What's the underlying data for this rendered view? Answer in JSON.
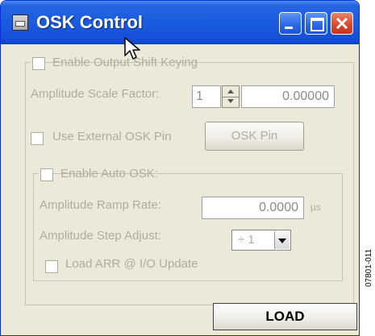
{
  "window": {
    "title": "OSK Control"
  },
  "title_controls": {
    "minimize": "minimize-button",
    "maximize": "maximize-button",
    "close": "close-button"
  },
  "osk": {
    "enable_label": "Enable Output Shift Keying",
    "enable_checked": false,
    "amplitude_scale_label": "Amplitude Scale Factor:",
    "amplitude_scale_step": "1",
    "amplitude_scale_value": "0.00000",
    "use_external_label": "Use External OSK Pin",
    "use_external_checked": false,
    "osk_pin_button": "OSK Pin"
  },
  "auto_osk": {
    "enable_label": "Enable Auto OSK:",
    "enable_checked": false,
    "ramp_rate_label": "Amplitude Ramp Rate:",
    "ramp_rate_value": "0.0000",
    "ramp_rate_unit": "µs",
    "step_adjust_label": "Amplitude Step Adjust:",
    "step_adjust_value": "÷ 1",
    "load_arr_label": "Load ARR @ I/O Update",
    "load_arr_checked": false
  },
  "footer": {
    "load_button": "LOAD",
    "figure_id": "07801-011"
  },
  "colors": {
    "titlebar": "#1a5de0",
    "window_bg": "#ece9d8",
    "disabled_text": "#b0aca0"
  }
}
